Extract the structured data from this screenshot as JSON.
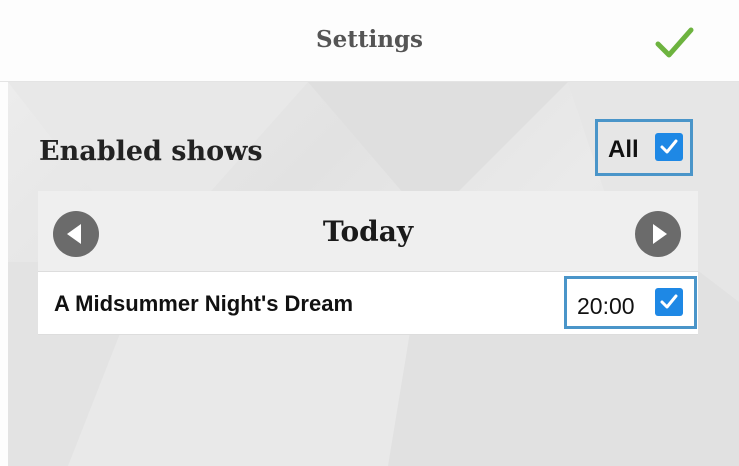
{
  "header": {
    "title": "Settings",
    "confirm_icon": "checkmark-icon",
    "confirm_color": "#6db33f"
  },
  "settings": {
    "section_title": "Enabled shows",
    "all_label": "All",
    "all_checked": true
  },
  "day_nav": {
    "label": "Today",
    "prev_icon": "chevron-left-circle-icon",
    "next_icon": "chevron-right-circle-icon"
  },
  "shows": [
    {
      "title": "A Midsummer Night's Dream",
      "time": "20:00",
      "checked": true
    }
  ],
  "colors": {
    "accent": "#1e88e5",
    "highlight_border": "#4a95c9",
    "nav_arrow": "#6b6b6b"
  }
}
